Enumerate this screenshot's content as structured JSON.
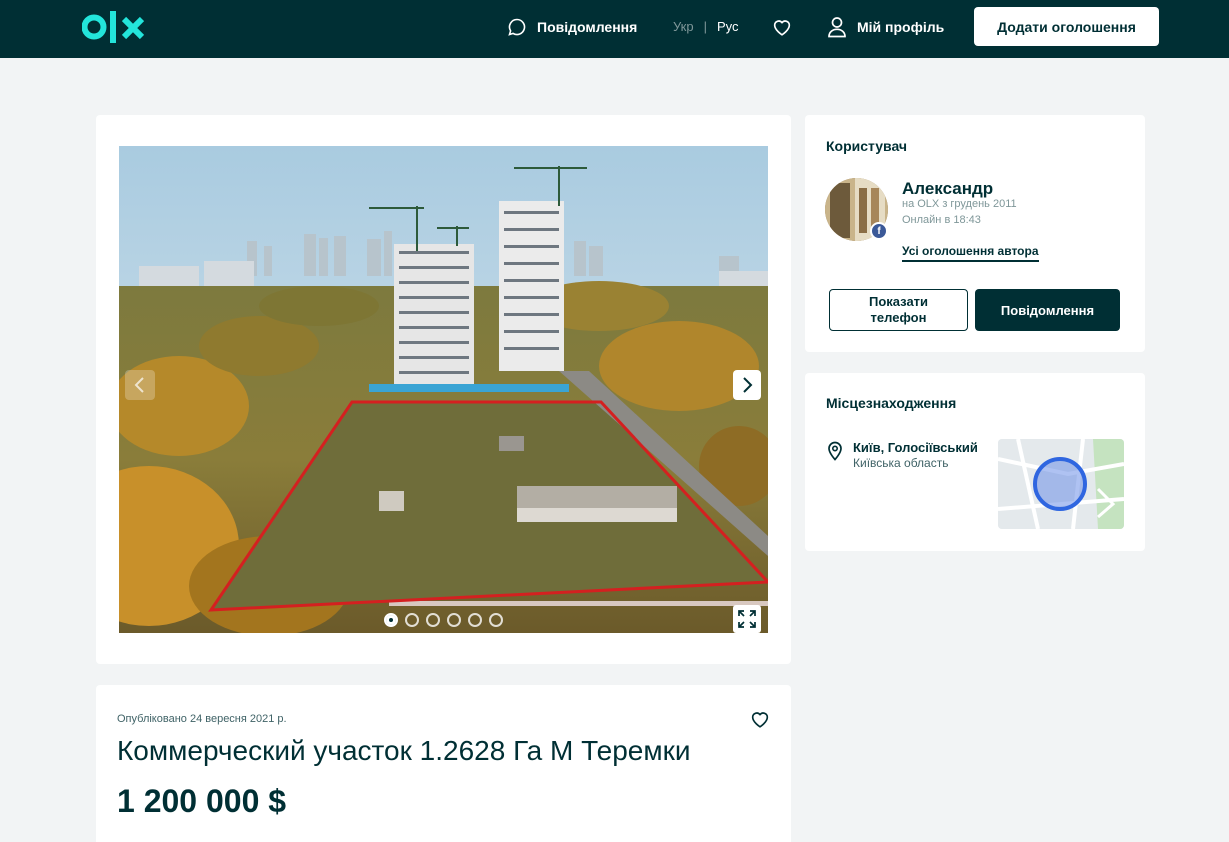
{
  "header": {
    "logo": "olx",
    "messages_label": "Повідомлення",
    "lang_ukr": "Укр",
    "lang_sep": "|",
    "lang_rus": "Рус",
    "profile_label": "Мій профіль",
    "add_button": "Додати оголошення"
  },
  "gallery": {
    "photos_count": 6,
    "active_index": 0
  },
  "ad": {
    "published": "Опубліковано 24 вересня 2021 р.",
    "title": "Коммерческий участок 1.2628 Га М Теремки",
    "price": "1 200 000 $"
  },
  "user": {
    "section_title": "Користувач",
    "name": "Александр",
    "since": "на OLX з грудень 2011",
    "online": "Онлайн в 18:43",
    "all_ads_link": "Усі оголошення автора",
    "show_phone_button": "Показати телефон",
    "message_button": "Повідомлення",
    "fb_badge": "f"
  },
  "location": {
    "section_title": "Місцезнаходження",
    "city": "Київ, Голосіївський",
    "region": "Київська область"
  },
  "colors": {
    "brand_dark": "#002f34",
    "logo_accent": "#23e5db",
    "page_bg": "#f2f4f5"
  }
}
